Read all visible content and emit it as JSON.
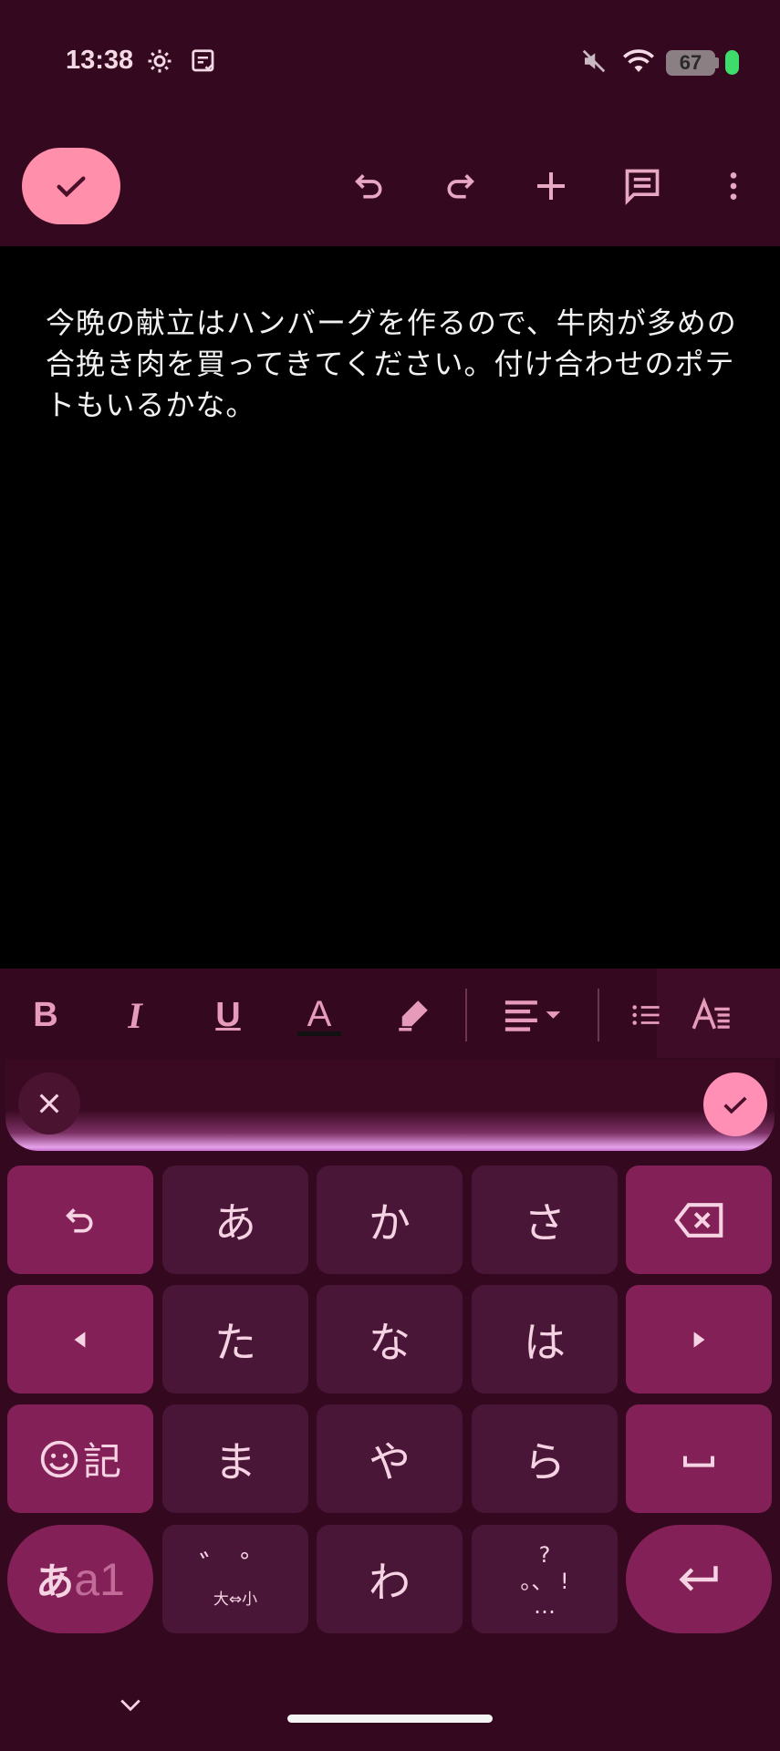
{
  "status_bar": {
    "time": "13:38",
    "battery_level": "67",
    "icons": [
      "settings-icon",
      "note-icon",
      "mute-icon",
      "wifi-icon"
    ]
  },
  "toolbar": {
    "done_icon": "check-icon",
    "actions": [
      "undo-icon",
      "redo-icon",
      "add-icon",
      "comment-icon",
      "more-icon"
    ]
  },
  "document": {
    "text": "今晩の献立はハンバーグを作るので、牛肉が多めの合挽き肉を買ってきてください。付け合わせのポテトもいるかな。"
  },
  "format_bar": {
    "bold": "B",
    "italic": "I",
    "underline": "U",
    "text_color": "A",
    "items": [
      "bold-icon",
      "italic-icon",
      "underline-icon",
      "text-color-icon",
      "highlight-icon",
      "align-icon",
      "list-icon",
      "text-style-icon"
    ]
  },
  "keyboard": {
    "row1": [
      "あ",
      "か",
      "さ"
    ],
    "row2": [
      "た",
      "な",
      "は"
    ],
    "row3": [
      "ま",
      "や",
      "ら"
    ],
    "emoji_key": "記",
    "mode_key_main": "あ",
    "mode_key_sub": "a1",
    "dakuten_top": "゛ ゜",
    "dakuten_bottom": "大⇔小",
    "wa": "わ",
    "punct_top": "?",
    "punct_mid": "。、 !",
    "punct_bottom": "…"
  },
  "colors": {
    "background": "#34081f",
    "accent": "#ff8fab",
    "key": "#4a1638",
    "function_key": "#832057"
  }
}
